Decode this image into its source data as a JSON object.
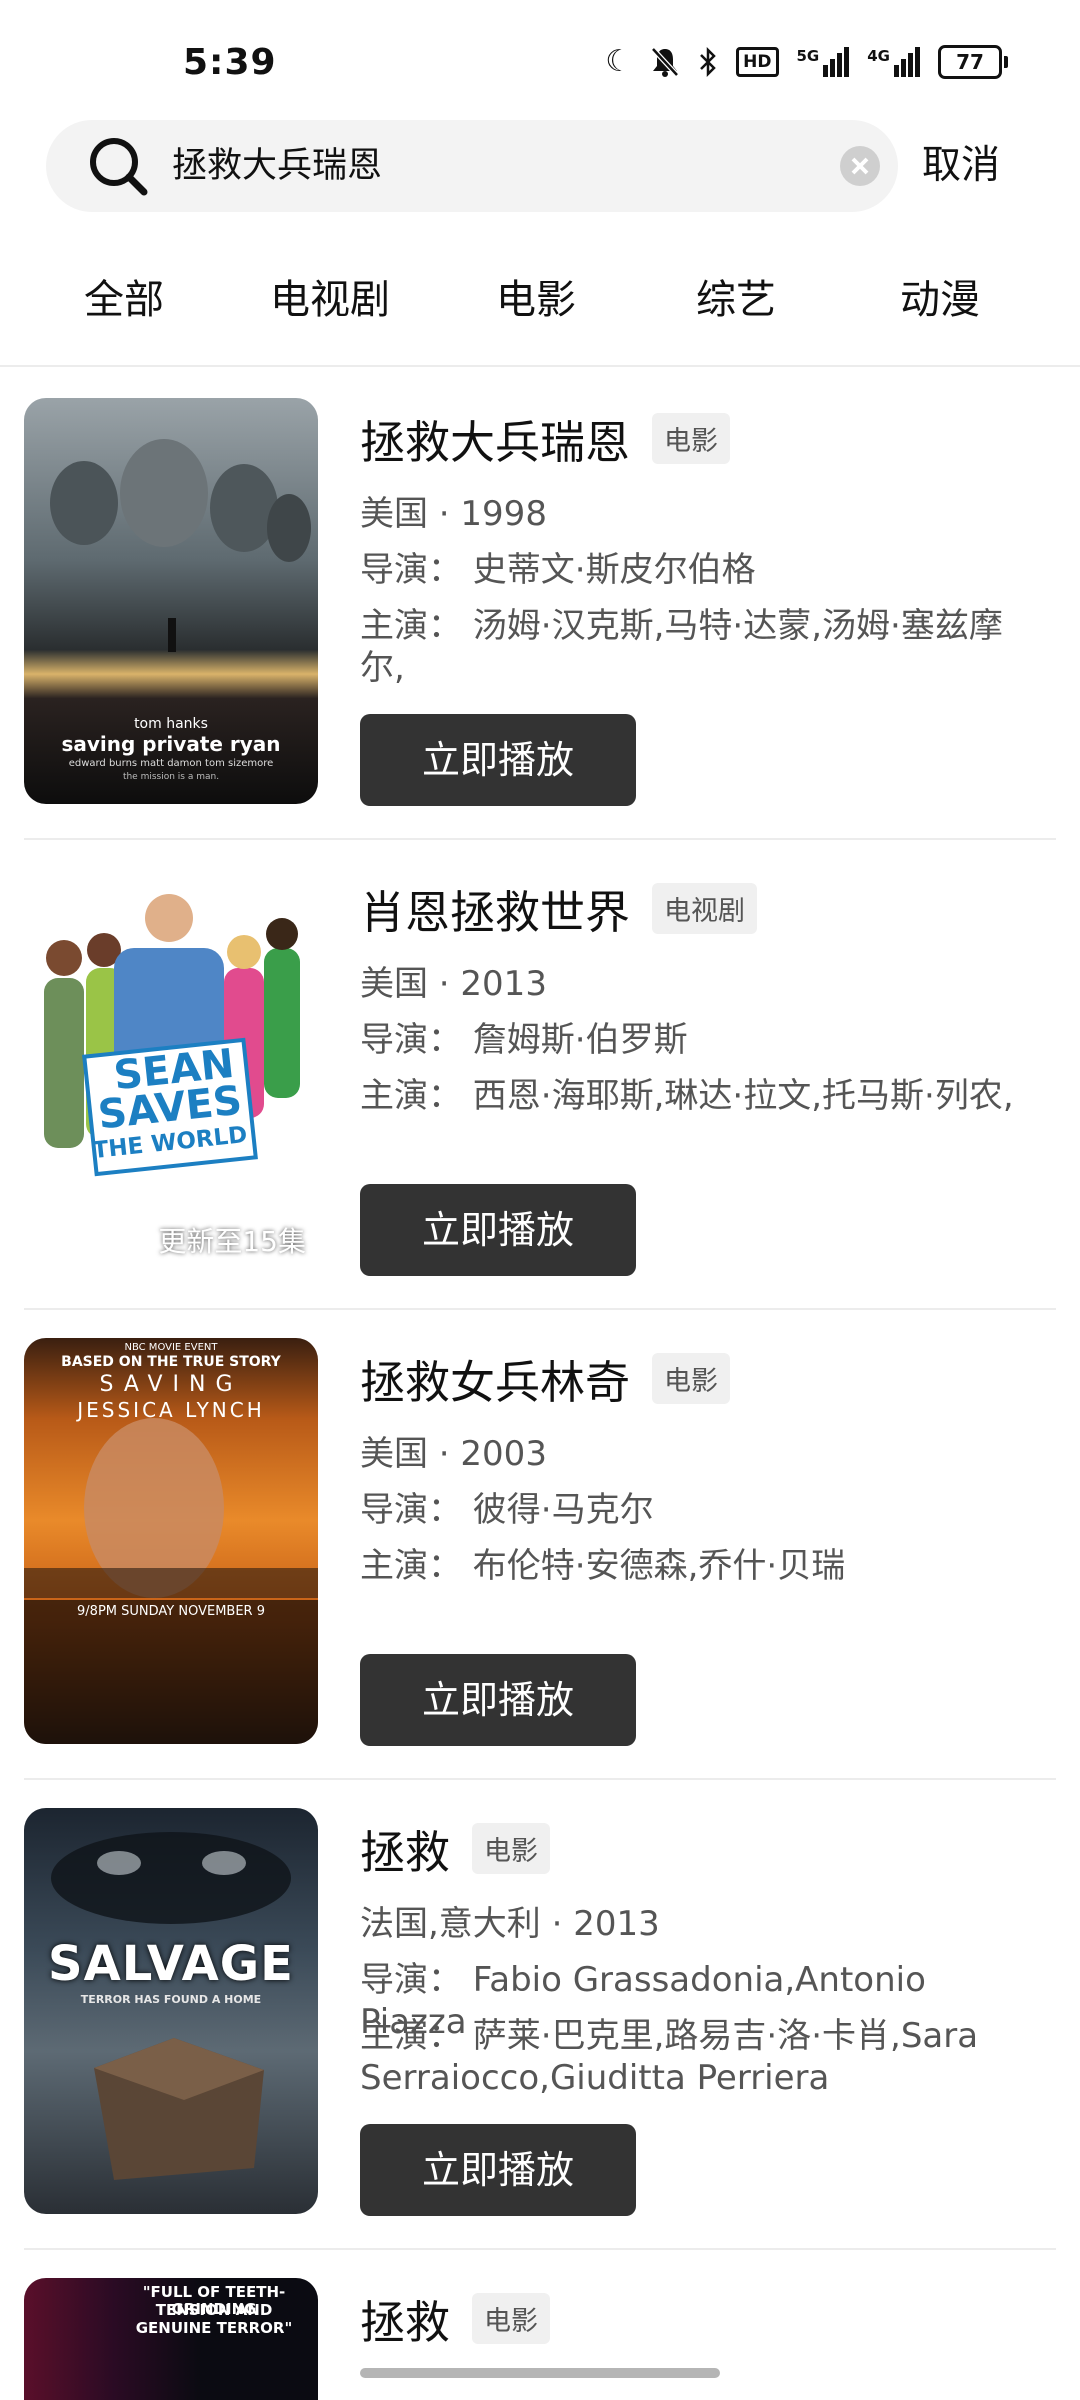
{
  "status": {
    "time": "5:39",
    "network_1": "5G",
    "network_2": "4G",
    "hd": "HD",
    "battery": "77"
  },
  "search": {
    "query": "拯救大兵瑞恩",
    "cancel_label": "取消"
  },
  "tabs": [
    "全部",
    "电视剧",
    "电影",
    "综艺",
    "动漫"
  ],
  "results": [
    {
      "title": "拯救大兵瑞恩",
      "type": "电影",
      "region_year": "美国 · 1998",
      "director": "导演：  史蒂文·斯皮尔伯格",
      "cast": "主演：  汤姆·汉克斯,马特·达蒙,汤姆·塞兹摩尔,",
      "play_label": "立即播放",
      "poster": {
        "line1": "tom hanks",
        "line2": "saving private ryan",
        "line3": "edward burns   matt damon   tom sizemore",
        "line4": "the mission is a man."
      }
    },
    {
      "title": "肖恩拯救世界",
      "type": "电视剧",
      "region_year": "美国 · 2013",
      "director": "导演：  詹姆斯·伯罗斯",
      "cast": "主演：  西恩·海耶斯,琳达·拉文,托马斯·列农,",
      "play_label": "立即播放",
      "update_badge": "更新至15集",
      "poster": {
        "line1": "SEAN",
        "line2": "SAVES",
        "line3": "THE WORLD"
      }
    },
    {
      "title": "拯救女兵林奇",
      "type": "电影",
      "region_year": "美国 · 2003",
      "director": "导演：  彼得·马克尔",
      "cast": "主演：  布伦特·安德森,乔什·贝瑞",
      "play_label": "立即播放",
      "poster": {
        "line1": "NBC MOVIE EVENT",
        "line2": "BASED ON THE TRUE STORY",
        "line3": "SAVING",
        "line4": "JESSICA LYNCH",
        "line5": "9/8PM SUNDAY NOVEMBER 9"
      }
    },
    {
      "title": "拯救",
      "type": "电影",
      "region_year": "法国,意大利 · 2013",
      "director": "导演：  Fabio Grassadonia,Antonio Piazza",
      "cast": "主演：  萨莱·巴克里,路易吉·洛·卡肖,Sara Serraiocco,Giuditta Perriera",
      "play_label": "立即播放",
      "poster": {
        "line1": "SALVAGE",
        "line2": "TERROR HAS FOUND A HOME"
      }
    },
    {
      "title": "拯救",
      "type": "电影",
      "poster": {
        "line1": "\"FULL OF TEETH-GRINDING",
        "line2": "TENSION AND",
        "line3": "GENUINE TERROR\""
      }
    }
  ],
  "colors": {
    "button_bg": "#333333",
    "badge_bg": "#f0f0f0",
    "search_bg": "#f3f3f3"
  }
}
